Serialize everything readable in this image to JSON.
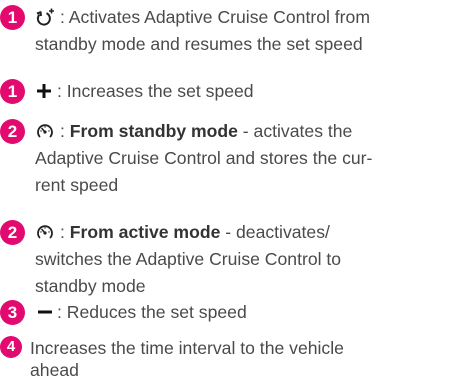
{
  "items": [
    {
      "number": "1",
      "icon": "resume-arrow-icon",
      "text_start": ": Activates Adaptive Cruise Control from",
      "text_line2": "standby mode and resumes the set speed"
    },
    {
      "number": "1",
      "icon": "plus-icon",
      "text_start": ": Increases the set speed"
    },
    {
      "number": "2",
      "icon": "speedometer-icon",
      "separator": ": ",
      "bold": "From standby mode",
      "text_start": " - activates the",
      "text_line2": "Adaptive Cruise Control and stores the cur-",
      "text_line3": "rent speed"
    },
    {
      "number": "2",
      "icon": "speedometer-icon",
      "separator": ": ",
      "bold": "From active mode",
      "text_start": " - deactivates/",
      "text_line2": "switches the Adaptive Cruise Control to",
      "text_line3": "standby mode"
    },
    {
      "number": "3",
      "icon": "minus-icon",
      "text_start": ": Reduces the set speed"
    },
    {
      "number": "4",
      "text_start": "Increases the time interval to the vehicle",
      "text_line2": "ahead"
    }
  ],
  "colors": {
    "badge": "#e30a6f",
    "text": "#4a4a4a"
  }
}
